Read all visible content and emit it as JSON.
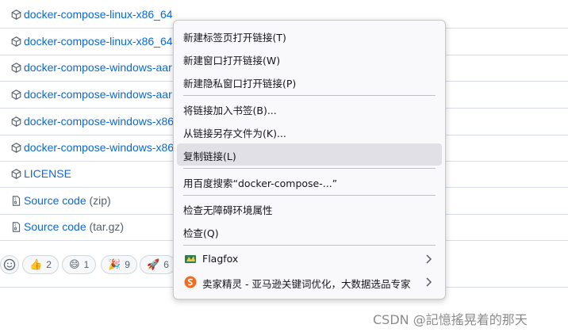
{
  "assets": [
    {
      "name": "docker-compose-linux-x86_64",
      "suffix": ""
    },
    {
      "name": "docker-compose-linux-x86_64",
      "suffix": ""
    },
    {
      "name": "docker-compose-windows-aar",
      "suffix": ""
    },
    {
      "name": "docker-compose-windows-aar",
      "suffix": ""
    },
    {
      "name": "docker-compose-windows-x86",
      "suffix": ""
    },
    {
      "name": "docker-compose-windows-x86",
      "suffix": ""
    },
    {
      "name": "LICENSE",
      "suffix": ""
    },
    {
      "name": "Source code",
      "suffix": " (zip)"
    },
    {
      "name": "Source code",
      "suffix": " (tar.gz)"
    }
  ],
  "reactions": [
    {
      "emoji": "👍",
      "count": "2"
    },
    {
      "emoji": "😄",
      "count": "1"
    },
    {
      "emoji": "🎉",
      "count": "9"
    },
    {
      "emoji": "🚀",
      "count": "6"
    }
  ],
  "menu": {
    "items": [
      {
        "label": "新建标签页打开链接(T)"
      },
      {
        "label": "新建窗口打开链接(W)"
      },
      {
        "label": "新建隐私窗口打开链接(P)"
      },
      {
        "label": "将链接加入书签(B)..."
      },
      {
        "label": "从链接另存文件为(K)..."
      },
      {
        "label": "复制链接(L)"
      },
      {
        "label": "用百度搜索“docker-compose-...”"
      },
      {
        "label": "检查无障碍环境属性"
      },
      {
        "label": "检查(Q)"
      },
      {
        "label": "Flagfox"
      },
      {
        "label": "卖家精灵 - 亚马逊关键词优化，大数据选品专家"
      }
    ]
  },
  "watermark": "CSDN @記憶搖晃着的那天",
  "colors": {
    "link": "#0969da",
    "highlight": "#e0e0e6",
    "menu_bg": "#f9f9fb"
  }
}
